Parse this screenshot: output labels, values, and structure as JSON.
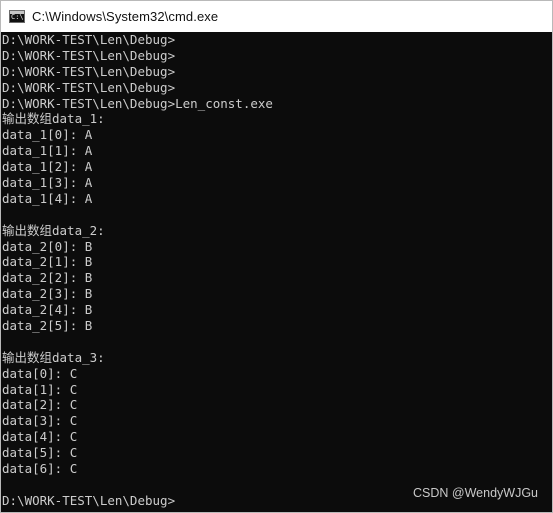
{
  "window": {
    "title": "C:\\Windows\\System32\\cmd.exe",
    "icon": "cmd-app-icon"
  },
  "console": {
    "lines": [
      "D:\\WORK-TEST\\Len\\Debug>",
      "D:\\WORK-TEST\\Len\\Debug>",
      "D:\\WORK-TEST\\Len\\Debug>",
      "D:\\WORK-TEST\\Len\\Debug>",
      "D:\\WORK-TEST\\Len\\Debug>Len_const.exe",
      "输出数组data_1:",
      "data_1[0]: A",
      "data_1[1]: A",
      "data_1[2]: A",
      "data_1[3]: A",
      "data_1[4]: A",
      "",
      "输出数组data_2:",
      "data_2[0]: B",
      "data_2[1]: B",
      "data_2[2]: B",
      "data_2[3]: B",
      "data_2[4]: B",
      "data_2[5]: B",
      "",
      "输出数组data_3:",
      "data[0]: C",
      "data[1]: C",
      "data[2]: C",
      "data[3]: C",
      "data[4]: C",
      "data[5]: C",
      "data[6]: C",
      "",
      "D:\\WORK-TEST\\Len\\Debug>"
    ]
  },
  "watermark": "CSDN @WendyWJGu"
}
